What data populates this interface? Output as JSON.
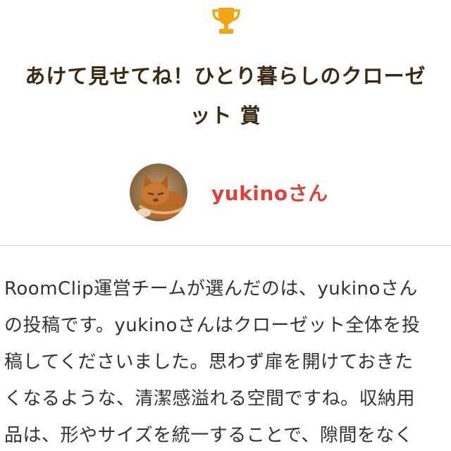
{
  "award": {
    "icon": "trophy-icon",
    "icon_color": "#f2a515",
    "title_line1": "あけて見せてね！ひとり暮らしのクローゼ",
    "title_line2": "ット 賞"
  },
  "winner": {
    "avatar": "cat-avatar",
    "name": "yukinoさん",
    "name_color": "#d9433a"
  },
  "description": {
    "lines": [
      "RoomClip運営チームが選んだのは、yukinoさん",
      "の投稿です。yukinoさんはクローゼット全体を投",
      "稿してくださいました。思わず扉を開けておきた",
      "くなるような、清潔感溢れる空間ですね。収納用",
      "品は、形やサイズを統一することで、隙間をなく"
    ]
  }
}
